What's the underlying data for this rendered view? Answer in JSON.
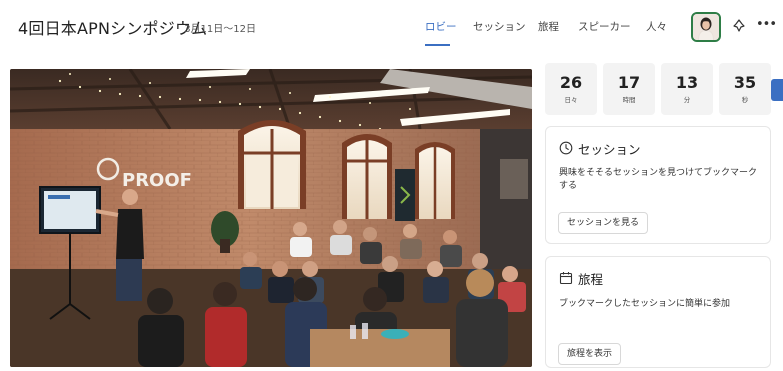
{
  "header": {
    "title": "4回日本APNシンポジウム",
    "dates": "3月11日～12日",
    "avatar_icon": "user-portrait"
  },
  "nav": {
    "tabs": [
      {
        "label": "ロビー",
        "active": true
      },
      {
        "label": "セッション",
        "active": false
      },
      {
        "label": "旅程",
        "active": false
      },
      {
        "label": "スピーカー",
        "active": false
      },
      {
        "label": "人々",
        "active": false
      }
    ],
    "accent_color": "#3b6fc2"
  },
  "hero": {
    "sign_text": "PROOF",
    "description": "Conference room photo with presenter and audience"
  },
  "countdown": [
    {
      "value": "26",
      "unit": "日々"
    },
    {
      "value": "17",
      "unit": "時間"
    },
    {
      "value": "13",
      "unit": "分"
    },
    {
      "value": "35",
      "unit": "秒"
    }
  ],
  "cards": {
    "sessions": {
      "icon": "clock-icon",
      "title": "セッション",
      "description": "興味をそそるセッションを見つけてブックマークする",
      "button": "セッションを見る"
    },
    "itinerary": {
      "icon": "calendar-icon",
      "title": "旅程",
      "description": "ブックマークしたセッションに簡単に参加",
      "button": "旅程を表示"
    }
  }
}
